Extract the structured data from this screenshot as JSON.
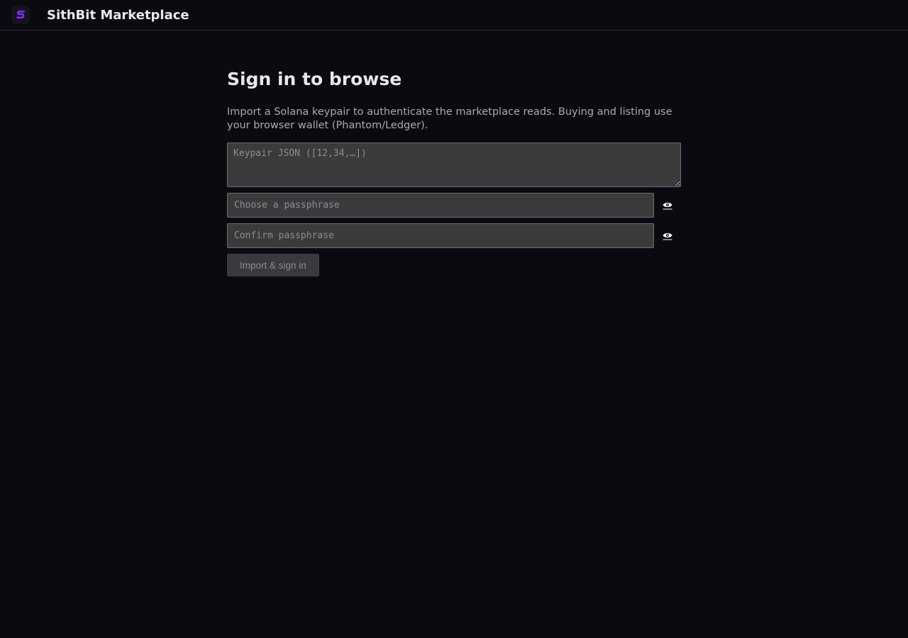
{
  "header": {
    "logo_icon": "sithbit-s-logo",
    "brand": "SithBit Marketplace",
    "accent_color": "#7b2ff7"
  },
  "signin": {
    "title": "Sign in to browse",
    "description": "Import a Solana keypair to authenticate the marketplace reads. Buying and listing use your browser wallet (Phantom/Ledger).",
    "keypair_placeholder": "Keypair JSON ([12,34,…])",
    "keypair_value": "",
    "passphrase_placeholder": "Choose a passphrase",
    "passphrase_value": "",
    "confirm_placeholder": "Confirm passphrase",
    "confirm_value": "",
    "toggle_icon": "eye-icon",
    "submit_label": "Import & sign in"
  }
}
